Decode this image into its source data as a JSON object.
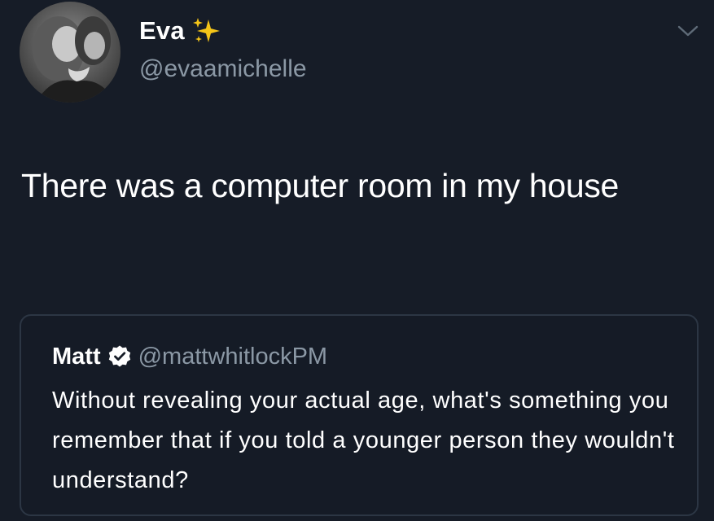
{
  "tweet": {
    "author": {
      "display_name": "Eva",
      "handle": "@evaamichelle",
      "name_emoji_icon": "sparkles-icon",
      "avatar_icon": "profile-photo"
    },
    "text": "There was a computer room in my house",
    "menu_icon": "chevron-down-icon"
  },
  "quoted_tweet": {
    "author": {
      "display_name": "Matt",
      "handle": "@mattwhitlockPM",
      "badge_icon": "verified-badge-icon"
    },
    "text": "Without revealing your actual age, what's something you remember that if you told a younger person they wouldn't understand?"
  },
  "colors": {
    "background": "#161c27",
    "text_primary": "#ffffff",
    "text_secondary": "#8b98a5",
    "card_border": "#2c3644",
    "sparkle": "#f5c518"
  }
}
